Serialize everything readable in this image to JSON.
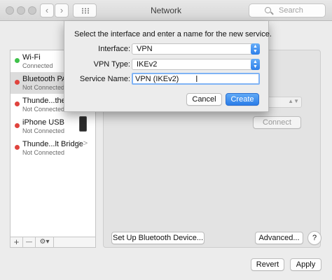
{
  "window": {
    "title": "Network"
  },
  "toolbar": {
    "back_glyph": "‹",
    "forward_glyph": "›",
    "grid_icon": "grid-icon",
    "search": {
      "placeholder": "Search",
      "icon": "search-icon"
    }
  },
  "services": [
    {
      "name": "Wi-Fi",
      "status": "Connected",
      "dot_color": "#3fc14a"
    },
    {
      "name": "Bluetooth PAN",
      "status": "Not Connected",
      "dot_color": "#e0443e"
    },
    {
      "name": "Thunde...thernet",
      "status": "Not Connected",
      "dot_color": "#e0443e"
    },
    {
      "name": "iPhone USB",
      "status": "Not Connected",
      "dot_color": "#e0443e"
    },
    {
      "name": "Thunde...lt Bridge",
      "status": "Not Connected",
      "dot_color": "#e0443e"
    }
  ],
  "sidebar_footer": {
    "add": "+",
    "remove": "—",
    "gear": "⚙▾"
  },
  "panel": {
    "connect_label": "Connect",
    "setup_bluetooth_label": "Set Up Bluetooth Device...",
    "advanced_label": "Advanced...",
    "help_label": "?"
  },
  "footer": {
    "revert_label": "Revert",
    "apply_label": "Apply"
  },
  "dialog": {
    "heading": "Select the interface and enter a name for the new service.",
    "interface_label": "Interface:",
    "interface_value": "VPN",
    "vpn_type_label": "VPN Type:",
    "vpn_type_value": "IKEv2",
    "service_name_label": "Service Name:",
    "service_name_value": "VPN (IKEv2)",
    "cancel_label": "Cancel",
    "create_label": "Create",
    "accent_color": "#2b7de8"
  }
}
